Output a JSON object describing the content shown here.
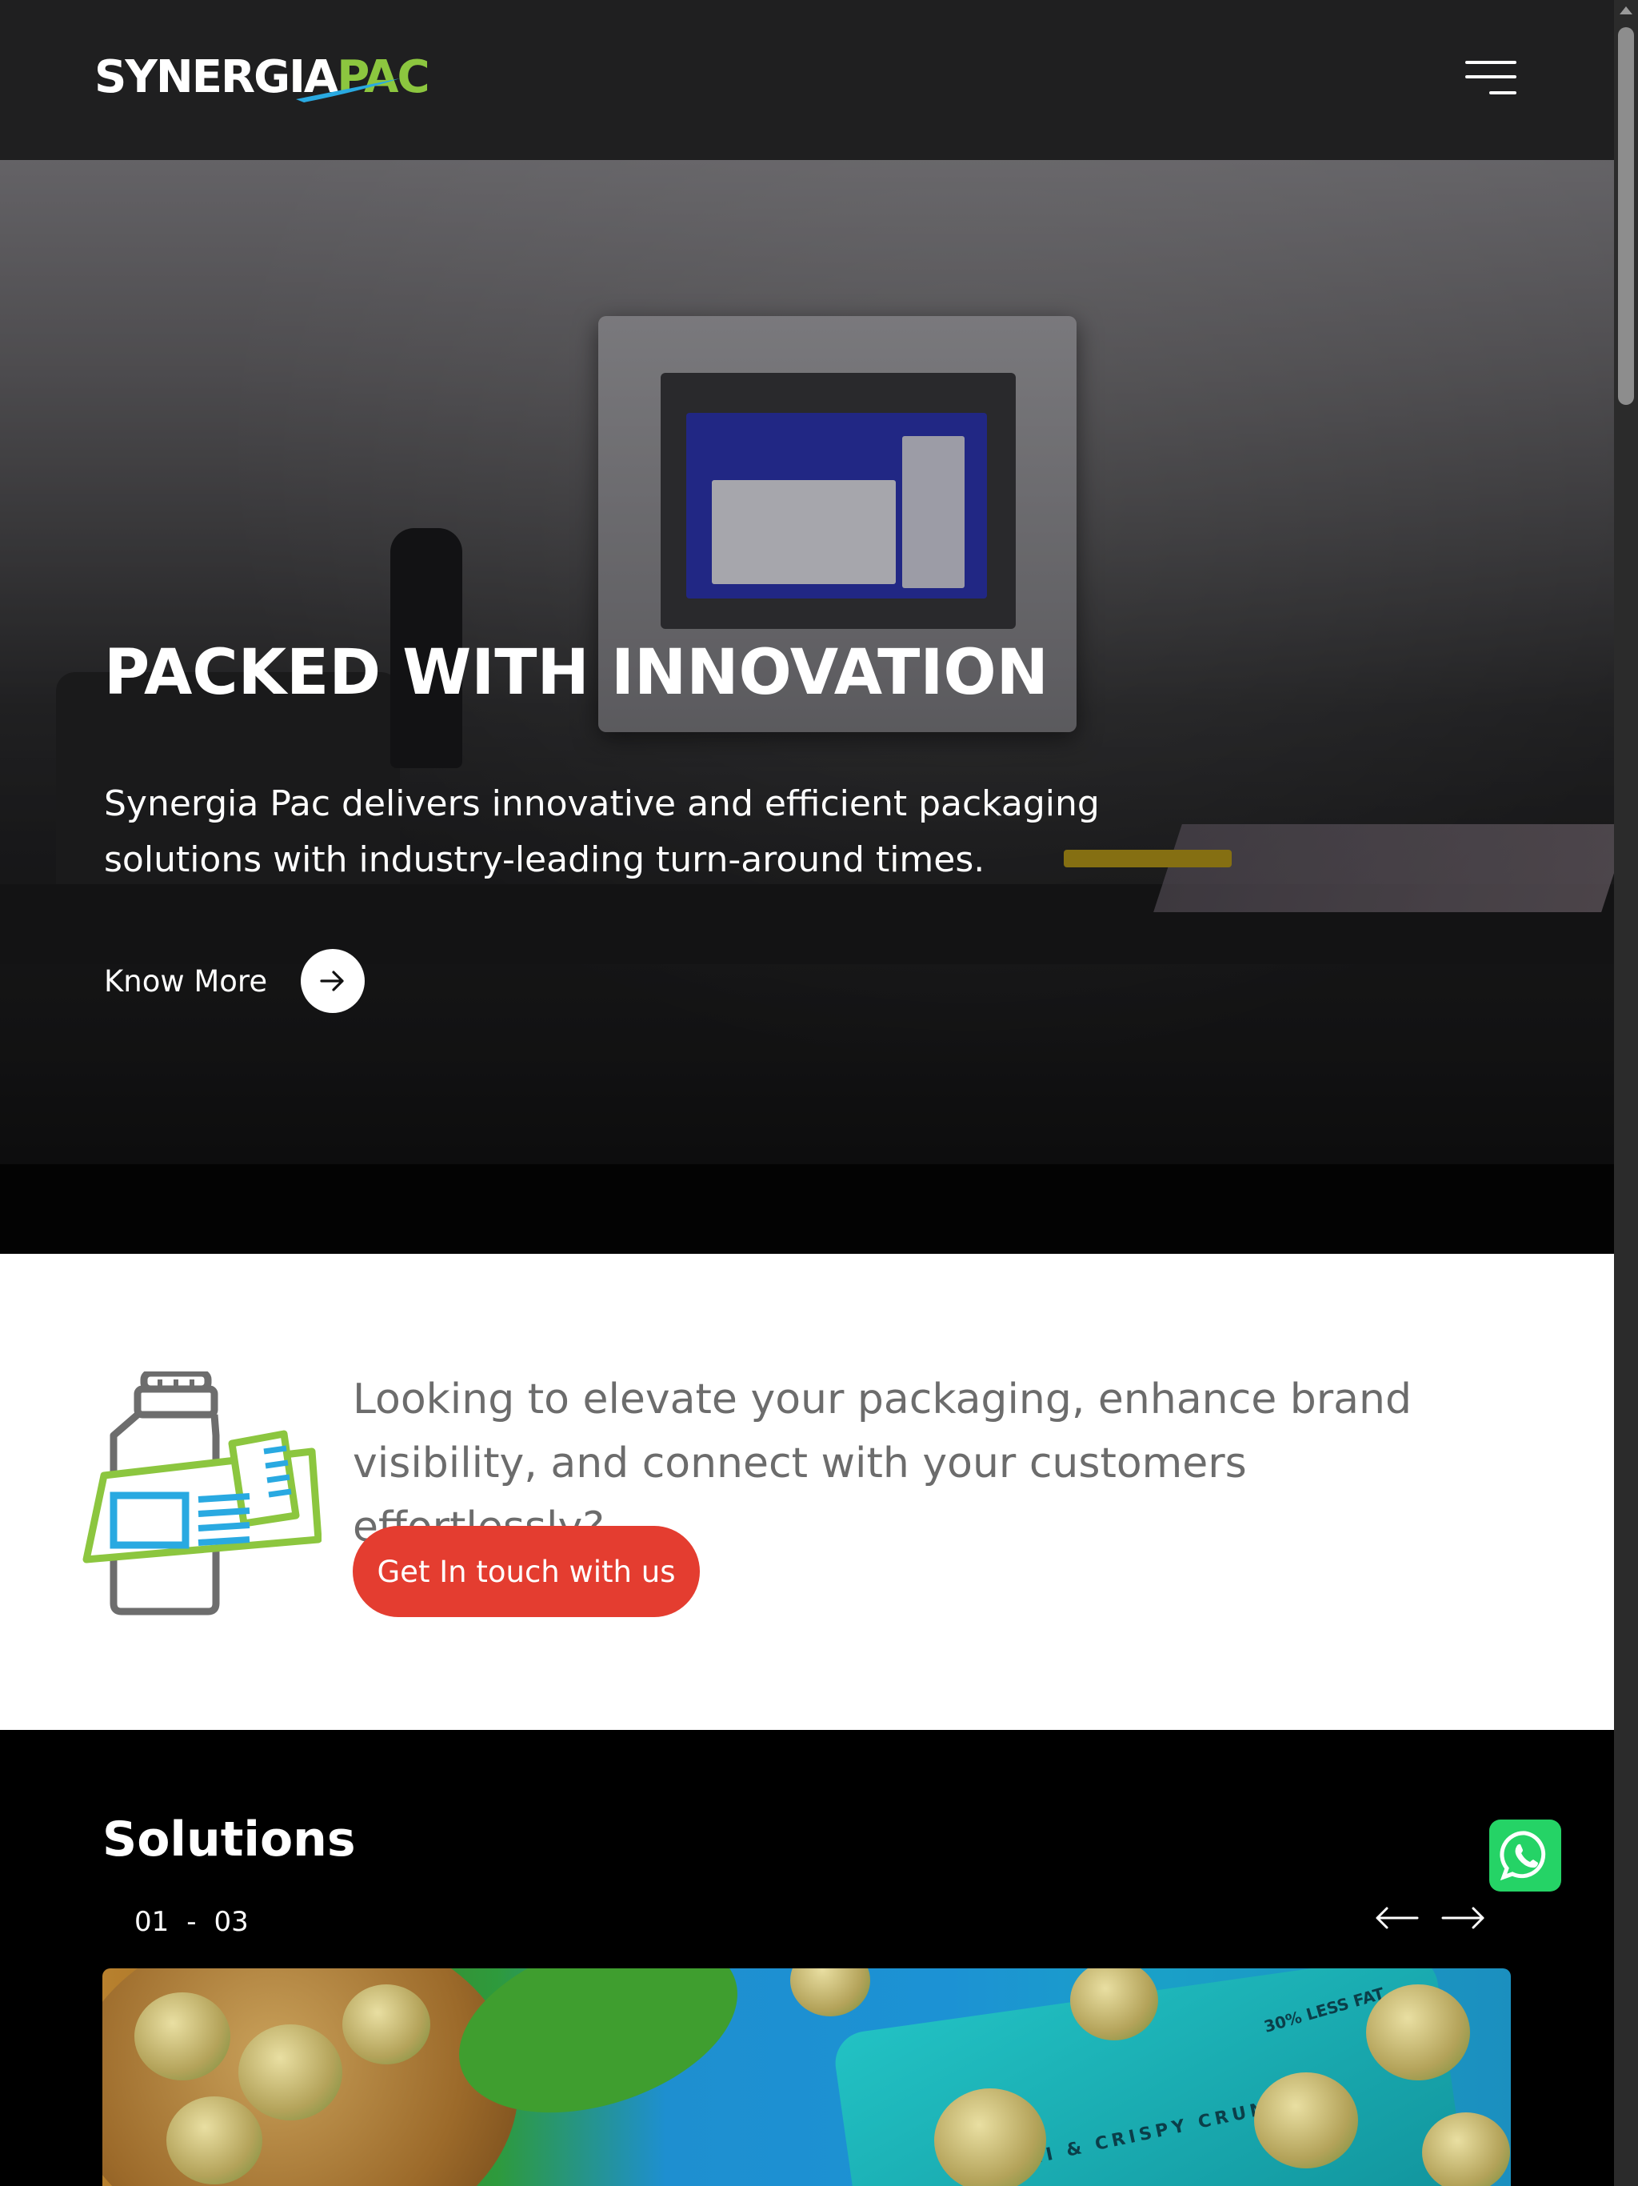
{
  "header": {
    "logo_word": "SYNERGIA",
    "logo_accent": "PAC",
    "menu_icon": "hamburger-menu-icon"
  },
  "hero": {
    "title": "PACKED WITH INNOVATION",
    "description": "Synergia Pac delivers innovative and efficient packaging solutions with industry-leading turn-around times.",
    "cta_label": "Know More",
    "cta_icon": "arrow-right-icon"
  },
  "cta": {
    "icon": "packaging-bottle-icon",
    "text": "Looking to elevate your packaging, enhance brand visibility, and connect with your customers effortlessly?",
    "button_label": "Get In touch with us"
  },
  "solutions": {
    "title": "Solutions",
    "counter_current": "01",
    "counter_sep": "-",
    "counter_total": "03",
    "prev_icon": "arrow-left-icon",
    "next_icon": "arrow-right-icon",
    "image_pack_text": "MI & CRISPY CRUNCH",
    "image_badge_text": "30% LESS FAT"
  },
  "whatsapp": {
    "icon": "whatsapp-icon"
  },
  "colors": {
    "header_bg": "#1f1f20",
    "brand_green": "#8cc63f",
    "brand_blue": "#29a9e1",
    "cta_red": "#e43d30",
    "text_grey": "#6c6c6c",
    "whatsapp_green": "#25d366"
  }
}
